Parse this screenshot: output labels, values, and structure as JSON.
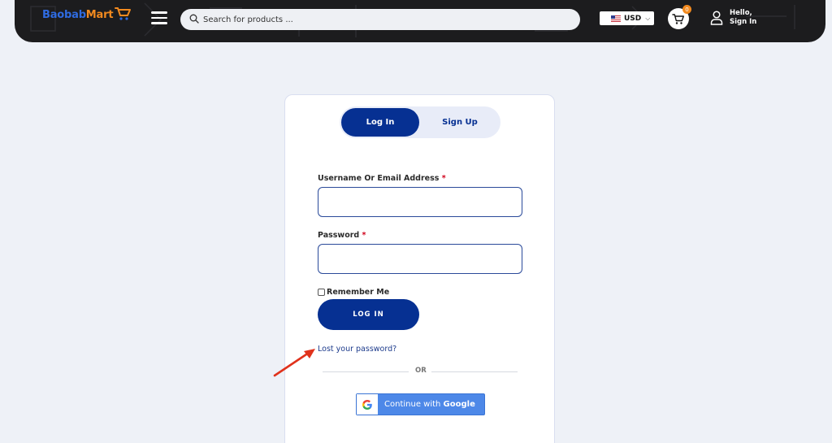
{
  "header": {
    "logo": {
      "part1": "Baobab",
      "part2": "Mart"
    },
    "search": {
      "placeholder": "Search for products ..."
    },
    "currency": {
      "label": "USD"
    },
    "cart": {
      "count": "0"
    },
    "account": {
      "line1": "Hello,",
      "line2": "Sign In"
    }
  },
  "auth": {
    "tabs": [
      {
        "label": "Log In",
        "active": true
      },
      {
        "label": "Sign Up",
        "active": false
      }
    ],
    "username": {
      "label": "Username Or Email Address",
      "required_mark": "*",
      "value": ""
    },
    "password": {
      "label": "Password",
      "required_mark": "*",
      "value": ""
    },
    "remember_label": "Remember Me",
    "login_button": "LOG IN",
    "lost_password": "Lost your password?",
    "divider_text": "OR",
    "google": {
      "prefix": "Continue with ",
      "brand": "Google"
    }
  },
  "colors": {
    "primary": "#063092",
    "accent_orange": "#f28a1f",
    "header_bg": "#1c1c1e",
    "google_blue": "#4d88e8",
    "annotation_arrow": "#e0321c"
  }
}
